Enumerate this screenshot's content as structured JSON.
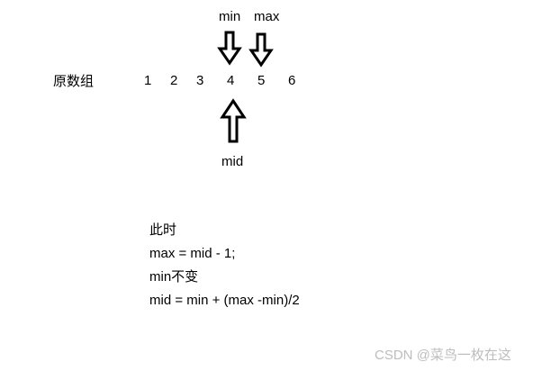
{
  "labels": {
    "min": "min",
    "max": "max",
    "mid": "mid",
    "array_label": "原数组"
  },
  "array": [
    "1",
    "2",
    "3",
    "4",
    "5",
    "6"
  ],
  "notes": {
    "line1": "此时",
    "line2": "max = mid - 1;",
    "line3": "min不变",
    "line4": "mid = min + (max -min)/2"
  },
  "watermark": "CSDN @菜鸟一枚在这"
}
